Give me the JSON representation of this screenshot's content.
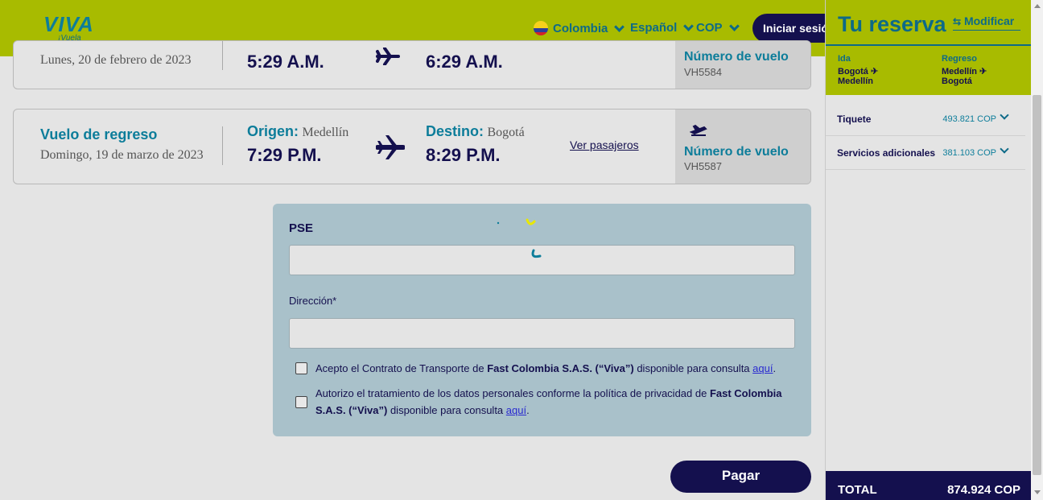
{
  "header": {
    "logo_text": "VIVA",
    "logo_tagline": "¡Vuela más!",
    "country": "Colombia",
    "language": "Español",
    "currency": "COP",
    "login": "Iniciar sesión"
  },
  "outbound": {
    "date": "Lunes, 20 de febrero de 2023",
    "departure_time": "5:29 A.M.",
    "arrival_time": "6:29 A.M.",
    "flight_number_label": "Número de vuelo",
    "flight_number": "VH5584"
  },
  "return": {
    "title": "Vuelo de regreso",
    "date": "Domingo, 19 de marzo de 2023",
    "origin_label": "Origen:",
    "origin": "Medellín",
    "destination_label": "Destino:",
    "destination": "Bogotá",
    "departure_time": "7:29 P.M.",
    "arrival_time": "8:29 P.M.",
    "passengers_link": "Ver pasajeros",
    "flight_number_label": "Número de vuelo",
    "flight_number": "VH5587"
  },
  "payment": {
    "title": "PSE",
    "address_label": "Dirección*",
    "consent1_pre": "Acepto el Contrato de Transporte de ",
    "consent1_bold": "Fast Colombia S.A.S. (“Viva”)",
    "consent1_post": " disponible para consulta ",
    "consent1_link": "aquí",
    "consent2_pre": "Autorizo el tratamiento de los datos personales conforme la política de privacidad de ",
    "consent2_bold": "Fast Colombia S.A.S. (“Viva”)",
    "consent2_post": " disponible para consulta ",
    "consent2_link": "aquí",
    "period": ".",
    "pay_button": "Pagar"
  },
  "sidebar": {
    "title": "Tu reserva",
    "modify": "Modificar",
    "outbound_label": "Ida",
    "outbound_from": "Bogotá ✈",
    "outbound_to": "Medellín",
    "return_label": "Regreso",
    "return_from": "Medellín ✈",
    "return_to": "Bogotá",
    "ticket_label": "Tiquete",
    "ticket_value": "493.821 COP",
    "services_label": "Servicios adicionales",
    "services_value": "381.103 COP",
    "total_label": "TOTAL",
    "total_value": "874.924 COP"
  },
  "colors": {
    "brand_lime": "#a8bb00",
    "brand_navy": "#14104e",
    "brand_teal": "#0d7d9a"
  }
}
